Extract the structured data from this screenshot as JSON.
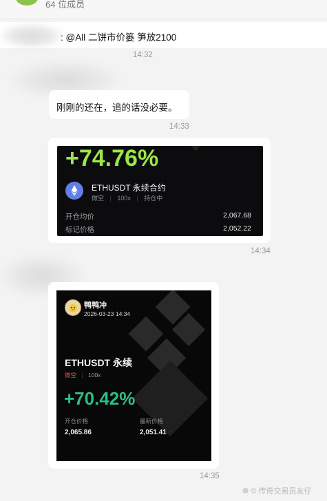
{
  "header": {
    "subtitle": "64 位成员"
  },
  "messages": [
    {
      "text": ": @All 二饼市价篓 笋放2100",
      "time": "14:32"
    },
    {
      "text": "刚刚的还在，追的话没必要。",
      "time": "14:33"
    },
    {
      "time": "14:34"
    },
    {
      "time": "14:35"
    }
  ],
  "card1": {
    "pnl": "+74.76%",
    "pair": "ETHUSDT 永续合约",
    "side": "做空",
    "leverage": "100x",
    "status": "持仓中",
    "rows": [
      {
        "label": "开仓均价",
        "value": "2,067.68"
      },
      {
        "label": "标记价格",
        "value": "2,052.22"
      }
    ]
  },
  "card2": {
    "user": "鸭鸭冲",
    "datetime": "2026-03-23 14:34",
    "pair": "ETHUSDT 永续",
    "side": "做空",
    "leverage": "100x",
    "pnl": "+70.42%",
    "entry_label": "开仓价格",
    "entry_value": "2,065.86",
    "last_label": "最新价格",
    "last_value": "2,051.41"
  },
  "watermark": "传奇交易员友仔",
  "colors": {
    "pnl_green_card1": "#9be64a",
    "pnl_green_card2": "#2ebd85",
    "short_red": "#f6465d",
    "eth_blue": "#627eea"
  }
}
